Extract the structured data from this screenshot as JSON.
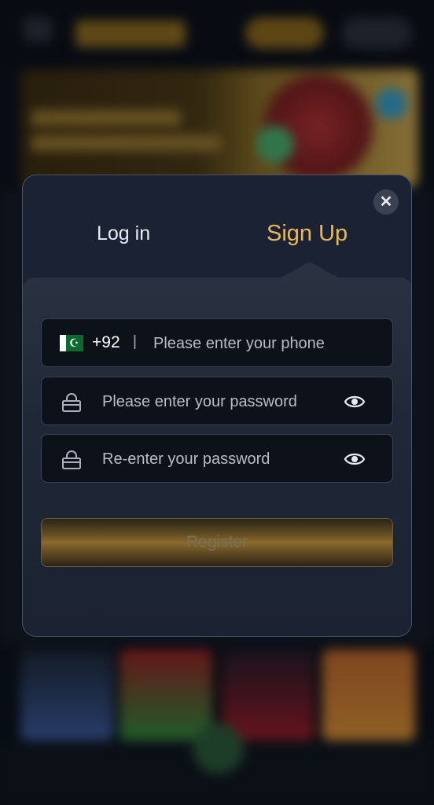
{
  "modal": {
    "close_icon": "close-icon",
    "tabs": [
      {
        "label": "Log in",
        "active": false
      },
      {
        "label": "Sign Up",
        "active": true
      }
    ],
    "phone": {
      "flag_icon": "pakistan-flag-icon",
      "country_code": "+92",
      "separator": "|",
      "placeholder": "Please enter your phone"
    },
    "password": {
      "icon": "lock-icon",
      "placeholder": "Please enter your password",
      "toggle_icon": "eye-icon"
    },
    "repassword": {
      "icon": "lock-icon",
      "placeholder": "Re-enter your password",
      "toggle_icon": "eye-icon"
    },
    "register_label": "Register"
  },
  "colors": {
    "accent": "#e8b85a",
    "modal_bg": "#1c2434",
    "field_bg": "#0d1119"
  }
}
